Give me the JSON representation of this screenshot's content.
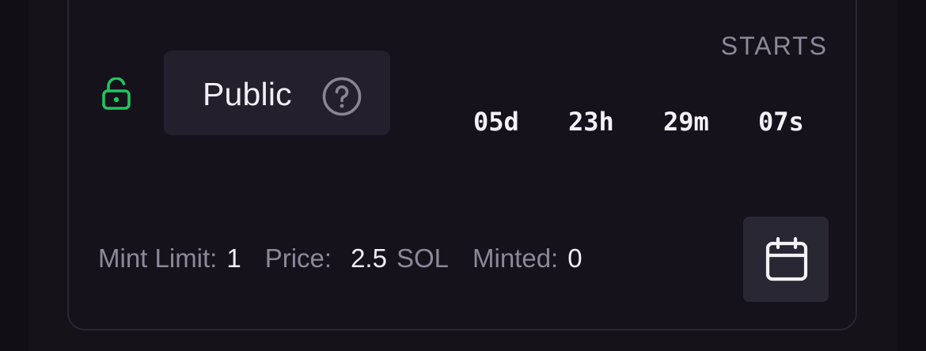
{
  "phase": {
    "label": "Public",
    "lock_icon": "unlock-icon",
    "help_icon": "question-circle-icon"
  },
  "countdown": {
    "title": "STARTS",
    "days": "05d",
    "hours": "23h",
    "minutes": "29m",
    "seconds": "07s"
  },
  "stats": {
    "mint_limit_label": "Mint Limit:",
    "mint_limit_value": "1",
    "price_label": "Price:",
    "price_value": "2.5",
    "price_unit": "SOL",
    "minted_label": "Minted:",
    "minted_value": "0"
  },
  "calendar_button": {
    "icon": "calendar-icon"
  },
  "colors": {
    "background": "#15121a",
    "card_border": "#2a2733",
    "pill": "#231f2d",
    "unlock_green": "#22c55e",
    "muted_text": "#8d8898",
    "primary_text": "#f1eef5"
  }
}
